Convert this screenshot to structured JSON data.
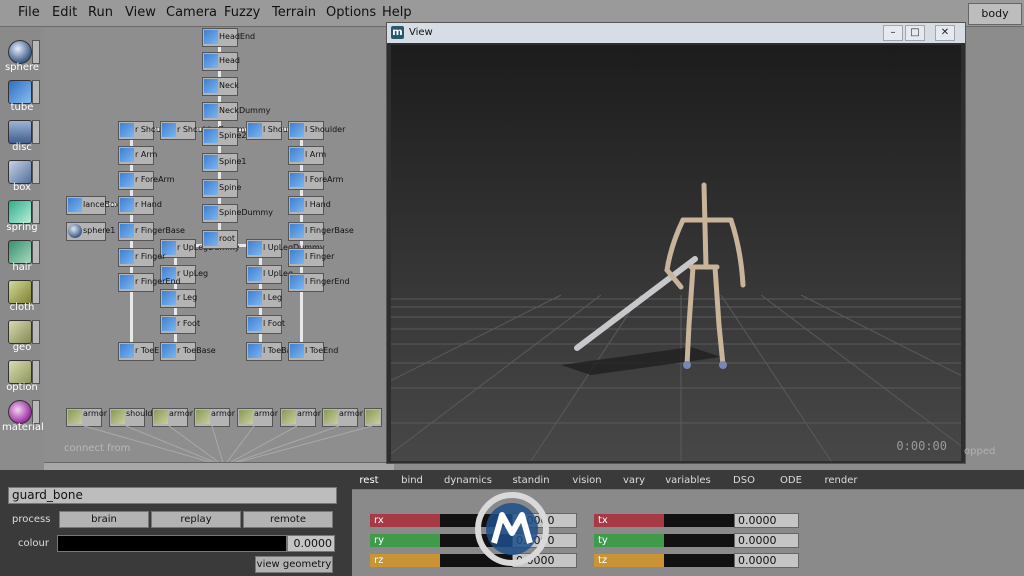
{
  "menubar": {
    "items": [
      "File",
      "Edit",
      "Run",
      "View",
      "Camera",
      "Fuzzy",
      "Terrain",
      "Options",
      "Help"
    ],
    "body_label": "body"
  },
  "toolbar": {
    "tools": [
      {
        "label": "sphere",
        "icon": "sphere-icon",
        "color": "#5b86c4"
      },
      {
        "label": "tube",
        "icon": "tube-icon",
        "color": "#4f8ad6"
      },
      {
        "label": "disc",
        "icon": "disc-icon",
        "color": "#6a8cbb"
      },
      {
        "label": "box",
        "icon": "box-icon",
        "color": "#6c83a5"
      },
      {
        "label": "spring",
        "icon": "spring-icon",
        "color": "#3bb08f"
      },
      {
        "label": "hair",
        "icon": "hair-icon",
        "color": "#4f9b7c"
      },
      {
        "label": "cloth",
        "icon": "cloth-icon",
        "color": "#9da24a"
      },
      {
        "label": "geo",
        "icon": "geo-icon",
        "color": "#a3a86c"
      },
      {
        "label": "option",
        "icon": "option-icon",
        "color": "#a3a86c"
      },
      {
        "label": "material",
        "icon": "material-icon",
        "color": "#b24bb0"
      }
    ]
  },
  "graph": {
    "nodes": [
      "HeadEnd",
      "Head",
      "Neck",
      "NeckDummy",
      "r Shoulder",
      "r ShoulderDummy",
      "Spine2",
      "l ShoulderDu",
      "l Shoulder",
      "r Arm",
      "Spine1",
      "l Arm",
      "r ForeArm",
      "Spine",
      "l ForeArm",
      "lanceBox",
      "r Hand",
      "SpineDummy",
      "l Hand",
      "sphere1",
      "r FingerBase",
      "r UpLegDummy",
      "root",
      "l UpLegDummy",
      "l FingerBase",
      "r Finger",
      "r UpLeg",
      "l UpLeg",
      "l Finger",
      "r FingerEnd",
      "r Leg",
      "l Leg",
      "l FingerEnd",
      "r Foot",
      "l Foot",
      "r ToeEnd",
      "r ToeBase",
      "l ToeBase",
      "l ToeEnd"
    ],
    "armor_row": [
      "armor lance",
      "shoulder armor",
      "armor boot",
      "armor boot",
      "armor pant",
      "armor arm",
      "armor arm",
      "armor"
    ],
    "connect_from": "connect from"
  },
  "view": {
    "title": "View",
    "logo": "m",
    "timecode": "0:00:00",
    "status": "opped"
  },
  "bottom": {
    "name_value": "guard_bone",
    "process_label": "process",
    "buttons": [
      "brain",
      "replay",
      "remote"
    ],
    "colour_label": "colour",
    "colour_value": "0.0000",
    "view_geometry": "view geometry"
  },
  "tabs": {
    "items": [
      "rest",
      "bind",
      "dynamics",
      "standin",
      "vision",
      "vary",
      "variables",
      "DSO",
      "ODE",
      "render"
    ],
    "active": "rest"
  },
  "attributes": {
    "left": [
      {
        "label": "rx",
        "color": "#a83a45",
        "value": "0.0000"
      },
      {
        "label": "ry",
        "color": "#3f9a4a",
        "value": "0.0000"
      },
      {
        "label": "rz",
        "color": "#c89436",
        "value": "0.0000"
      }
    ],
    "right": [
      {
        "label": "tx",
        "color": "#a83a45",
        "value": "0.0000"
      },
      {
        "label": "ty",
        "color": "#3f9a4a",
        "value": "0.0000"
      },
      {
        "label": "tz",
        "color": "#c89436",
        "value": "0.0000"
      }
    ]
  }
}
